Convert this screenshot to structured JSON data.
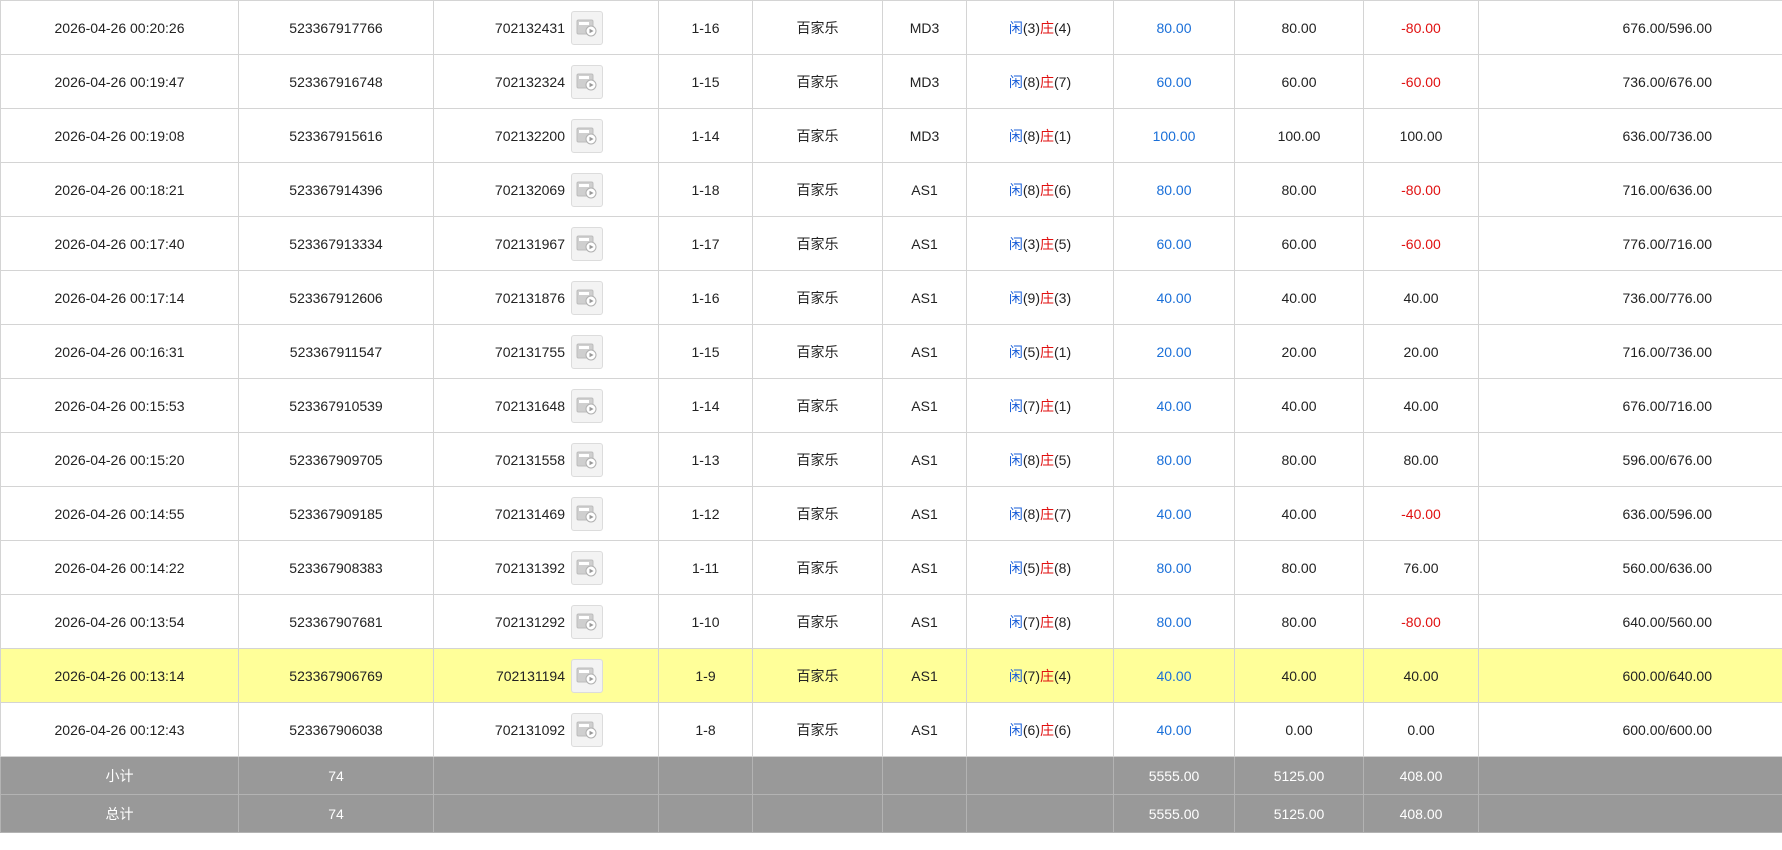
{
  "colors": {
    "highlight_row": "#ffff99",
    "summary_row": "#999999",
    "player_text": "#1a5fd8",
    "banker_text": "#e01010",
    "valid_bet_text": "#1a6fd8",
    "negative_text": "#e01010"
  },
  "icons": {
    "video": "video-replay-icon"
  },
  "rows": [
    {
      "time": "2026-04-26 00:20:26",
      "bet_id": "523367917766",
      "round_id": "702132431",
      "shoe": "1-16",
      "game": "百家乐",
      "table": "MD3",
      "player_label": "闲",
      "player_score": "(3)",
      "banker_label": "庄",
      "banker_score": "(4)",
      "bet": "80.00",
      "valid_bet": "80.00",
      "win_loss": "-80.00",
      "win_negative": true,
      "balance": "676.00/596.00"
    },
    {
      "time": "2026-04-26 00:19:47",
      "bet_id": "523367916748",
      "round_id": "702132324",
      "shoe": "1-15",
      "game": "百家乐",
      "table": "MD3",
      "player_label": "闲",
      "player_score": "(8)",
      "banker_label": "庄",
      "banker_score": "(7)",
      "bet": "60.00",
      "valid_bet": "60.00",
      "win_loss": "-60.00",
      "win_negative": true,
      "balance": "736.00/676.00"
    },
    {
      "time": "2026-04-26 00:19:08",
      "bet_id": "523367915616",
      "round_id": "702132200",
      "shoe": "1-14",
      "game": "百家乐",
      "table": "MD3",
      "player_label": "闲",
      "player_score": "(8)",
      "banker_label": "庄",
      "banker_score": "(1)",
      "bet": "100.00",
      "valid_bet": "100.00",
      "win_loss": "100.00",
      "win_negative": false,
      "balance": "636.00/736.00"
    },
    {
      "time": "2026-04-26 00:18:21",
      "bet_id": "523367914396",
      "round_id": "702132069",
      "shoe": "1-18",
      "game": "百家乐",
      "table": "AS1",
      "player_label": "闲",
      "player_score": "(8)",
      "banker_label": "庄",
      "banker_score": "(6)",
      "bet": "80.00",
      "valid_bet": "80.00",
      "win_loss": "-80.00",
      "win_negative": true,
      "balance": "716.00/636.00"
    },
    {
      "time": "2026-04-26 00:17:40",
      "bet_id": "523367913334",
      "round_id": "702131967",
      "shoe": "1-17",
      "game": "百家乐",
      "table": "AS1",
      "player_label": "闲",
      "player_score": "(3)",
      "banker_label": "庄",
      "banker_score": "(5)",
      "bet": "60.00",
      "valid_bet": "60.00",
      "win_loss": "-60.00",
      "win_negative": true,
      "balance": "776.00/716.00"
    },
    {
      "time": "2026-04-26 00:17:14",
      "bet_id": "523367912606",
      "round_id": "702131876",
      "shoe": "1-16",
      "game": "百家乐",
      "table": "AS1",
      "player_label": "闲",
      "player_score": "(9)",
      "banker_label": "庄",
      "banker_score": "(3)",
      "bet": "40.00",
      "valid_bet": "40.00",
      "win_loss": "40.00",
      "win_negative": false,
      "balance": "736.00/776.00"
    },
    {
      "time": "2026-04-26 00:16:31",
      "bet_id": "523367911547",
      "round_id": "702131755",
      "shoe": "1-15",
      "game": "百家乐",
      "table": "AS1",
      "player_label": "闲",
      "player_score": "(5)",
      "banker_label": "庄",
      "banker_score": "(1)",
      "bet": "20.00",
      "valid_bet": "20.00",
      "win_loss": "20.00",
      "win_negative": false,
      "balance": "716.00/736.00"
    },
    {
      "time": "2026-04-26 00:15:53",
      "bet_id": "523367910539",
      "round_id": "702131648",
      "shoe": "1-14",
      "game": "百家乐",
      "table": "AS1",
      "player_label": "闲",
      "player_score": "(7)",
      "banker_label": "庄",
      "banker_score": "(1)",
      "bet": "40.00",
      "valid_bet": "40.00",
      "win_loss": "40.00",
      "win_negative": false,
      "balance": "676.00/716.00"
    },
    {
      "time": "2026-04-26 00:15:20",
      "bet_id": "523367909705",
      "round_id": "702131558",
      "shoe": "1-13",
      "game": "百家乐",
      "table": "AS1",
      "player_label": "闲",
      "player_score": "(8)",
      "banker_label": "庄",
      "banker_score": "(5)",
      "bet": "80.00",
      "valid_bet": "80.00",
      "win_loss": "80.00",
      "win_negative": false,
      "balance": "596.00/676.00"
    },
    {
      "time": "2026-04-26 00:14:55",
      "bet_id": "523367909185",
      "round_id": "702131469",
      "shoe": "1-12",
      "game": "百家乐",
      "table": "AS1",
      "player_label": "闲",
      "player_score": "(8)",
      "banker_label": "庄",
      "banker_score": "(7)",
      "bet": "40.00",
      "valid_bet": "40.00",
      "win_loss": "-40.00",
      "win_negative": true,
      "balance": "636.00/596.00"
    },
    {
      "time": "2026-04-26 00:14:22",
      "bet_id": "523367908383",
      "round_id": "702131392",
      "shoe": "1-11",
      "game": "百家乐",
      "table": "AS1",
      "player_label": "闲",
      "player_score": "(5)",
      "banker_label": "庄",
      "banker_score": "(8)",
      "bet": "80.00",
      "valid_bet": "80.00",
      "win_loss": "76.00",
      "win_negative": false,
      "balance": "560.00/636.00"
    },
    {
      "time": "2026-04-26 00:13:54",
      "bet_id": "523367907681",
      "round_id": "702131292",
      "shoe": "1-10",
      "game": "百家乐",
      "table": "AS1",
      "player_label": "闲",
      "player_score": "(7)",
      "banker_label": "庄",
      "banker_score": "(8)",
      "bet": "80.00",
      "valid_bet": "80.00",
      "win_loss": "-80.00",
      "win_negative": true,
      "balance": "640.00/560.00"
    },
    {
      "time": "2026-04-26 00:13:14",
      "bet_id": "523367906769",
      "round_id": "702131194",
      "shoe": "1-9",
      "game": "百家乐",
      "table": "AS1",
      "player_label": "闲",
      "player_score": "(7)",
      "banker_label": "庄",
      "banker_score": "(4)",
      "bet": "40.00",
      "valid_bet": "40.00",
      "win_loss": "40.00",
      "win_negative": false,
      "balance": "600.00/640.00",
      "highlighted": true
    },
    {
      "time": "2026-04-26 00:12:43",
      "bet_id": "523367906038",
      "round_id": "702131092",
      "shoe": "1-8",
      "game": "百家乐",
      "table": "AS1",
      "player_label": "闲",
      "player_score": "(6)",
      "banker_label": "庄",
      "banker_score": "(6)",
      "bet": "40.00",
      "valid_bet": "0.00",
      "win_loss": "0.00",
      "win_negative": false,
      "balance": "600.00/600.00"
    }
  ],
  "subtotal": {
    "label": "小计",
    "count": "74",
    "bet": "5555.00",
    "valid_bet": "5125.00",
    "win_loss": "408.00"
  },
  "total": {
    "label": "总计",
    "count": "74",
    "bet": "5555.00",
    "valid_bet": "5125.00",
    "win_loss": "408.00"
  }
}
